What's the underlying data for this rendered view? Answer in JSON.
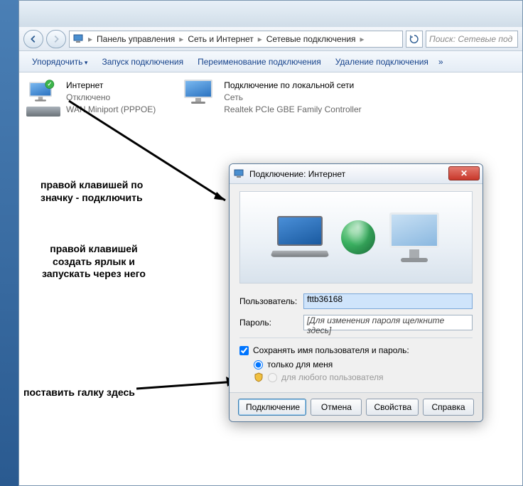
{
  "explorer": {
    "breadcrumb": {
      "seg1": "Панель управления",
      "seg2": "Сеть и Интернет",
      "seg3": "Сетевые подключения"
    },
    "search_placeholder": "Поиск: Сетевые под",
    "cmdbar": {
      "organize": "Упорядочить",
      "start_conn": "Запуск подключения",
      "rename": "Переименование подключения",
      "delete": "Удаление подключения",
      "more": "»"
    },
    "items": [
      {
        "name": "Интернет",
        "status": "Отключено",
        "device": "WAN Miniport (PPPOE)"
      },
      {
        "name": "Подключение по локальной сети",
        "status": "Сеть",
        "device": "Realtek PCIe GBE Family Controller"
      }
    ]
  },
  "dialog": {
    "title": "Подключение: Интернет",
    "user_label": "Пользователь:",
    "user_value": "fttb36168",
    "pass_label": "Пароль:",
    "pass_placeholder": "[Для изменения пароля щелкните здесь]",
    "save_label": "Сохранять имя пользователя и пароль:",
    "radio_me": "только для меня",
    "radio_any": "для любого пользователя",
    "btn_connect": "Подключение",
    "btn_cancel": "Отмена",
    "btn_props": "Свойства",
    "btn_help": "Справка"
  },
  "annotations": {
    "a1_l1": "правой клавишей по",
    "a1_l2": "значку - подключить",
    "a2_l1": "правой клавишей",
    "a2_l2": "создать ярлык и",
    "a2_l3": "запускать через него",
    "a3": "поставить галку здесь"
  }
}
